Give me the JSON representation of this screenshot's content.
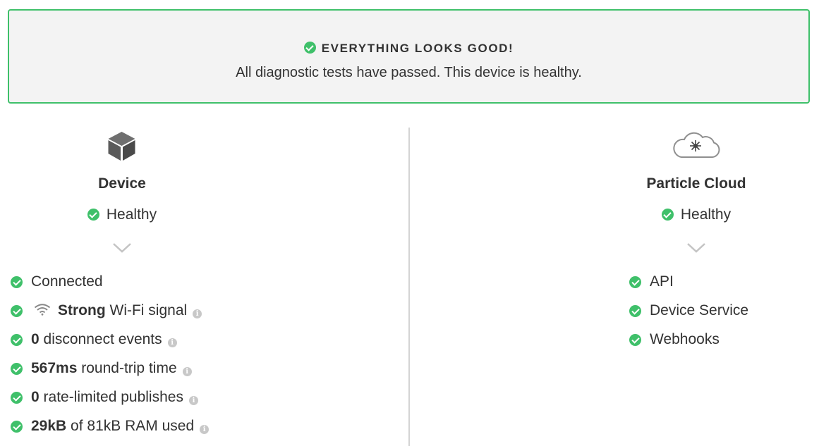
{
  "banner": {
    "title": "EVERYTHING LOOKS GOOD!",
    "message": "All diagnostic tests have passed. This device is healthy."
  },
  "device": {
    "icon": "cube-icon",
    "title": "Device",
    "status": "Healthy",
    "items": [
      {
        "value": "",
        "text": "Connected",
        "info": false
      },
      {
        "value": "Strong",
        "text": "Wi-Fi signal",
        "info": true,
        "icon": "wifi-icon"
      },
      {
        "value": "0",
        "text": "disconnect events",
        "info": true
      },
      {
        "value": "567ms",
        "text": "round-trip time",
        "info": true
      },
      {
        "value": "0",
        "text": "rate-limited publishes",
        "info": true
      },
      {
        "value": "29kB",
        "text": "of 81kB RAM used",
        "info": true
      }
    ]
  },
  "cloud": {
    "icon": "cloud-icon",
    "title": "Particle Cloud",
    "status": "Healthy",
    "items": [
      {
        "text": "API"
      },
      {
        "text": "Device Service"
      },
      {
        "text": "Webhooks"
      }
    ]
  },
  "colors": {
    "success": "#3fc06a",
    "banner_bg": "#f3f3f3",
    "text": "#333333",
    "divider": "#d4d4d4"
  }
}
